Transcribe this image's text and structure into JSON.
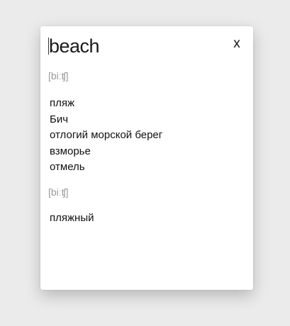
{
  "popup": {
    "headword": "beach",
    "close_label": "x",
    "groups": [
      {
        "transcription": "[biːʧ]",
        "translations": [
          "пляж",
          "Бич",
          "отлогий морской берег",
          "взморье",
          "отмель"
        ]
      },
      {
        "transcription": "[biːʧ]",
        "translations": [
          "пляжный"
        ]
      }
    ]
  }
}
